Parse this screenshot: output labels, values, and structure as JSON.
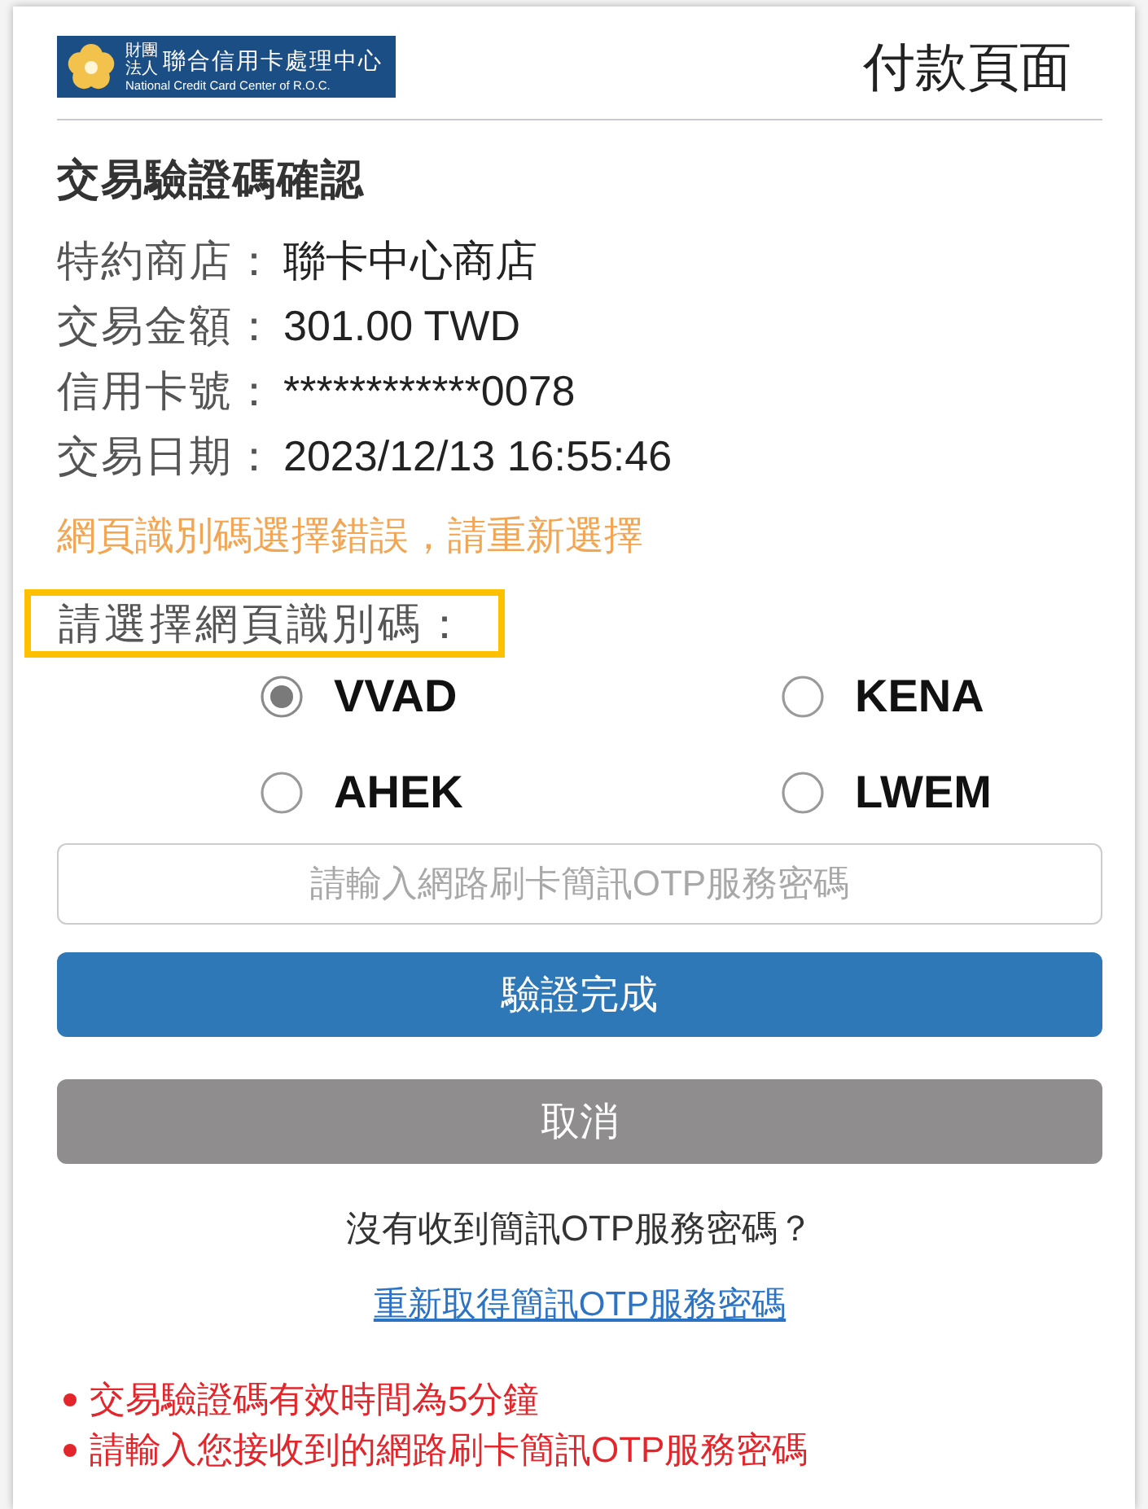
{
  "header": {
    "logo": {
      "prefix": "財團法人",
      "name_zh": "聯合信用卡處理中心",
      "name_en": "National Credit Card Center of R.O.C."
    },
    "title": "付款頁面"
  },
  "section_title": "交易驗證碼確認",
  "details": [
    {
      "label": "特約商店：",
      "value": "聯卡中心商店"
    },
    {
      "label": "交易金額：",
      "value": "301.00 TWD"
    },
    {
      "label": "信用卡號：",
      "value": "************0078"
    },
    {
      "label": "交易日期：",
      "value": "2023/12/13 16:55:46"
    }
  ],
  "error_message": "網頁識別碼選擇錯誤，請重新選擇",
  "code_prompt": {
    "label": "請選擇網頁識別碼：",
    "highlighted": true
  },
  "codes": [
    {
      "label": "VVAD",
      "selected": true
    },
    {
      "label": "KENA",
      "selected": false
    },
    {
      "label": "AHEK",
      "selected": false
    },
    {
      "label": "LWEM",
      "selected": false
    }
  ],
  "otp_field": {
    "placeholder": "請輸入網路刷卡簡訊OTP服務密碼"
  },
  "buttons": [
    {
      "label": "驗證完成",
      "kind": "primary"
    },
    {
      "label": "取消",
      "kind": "secondary"
    }
  ],
  "resend_prompt": "沒有收到簡訊OTP服務密碼？",
  "resend_link": "重新取得簡訊OTP服務密碼",
  "notes": [
    "交易驗證碼有效時間為5分鐘",
    "請輸入您接收到的網路刷卡簡訊OTP服務密碼"
  ]
}
